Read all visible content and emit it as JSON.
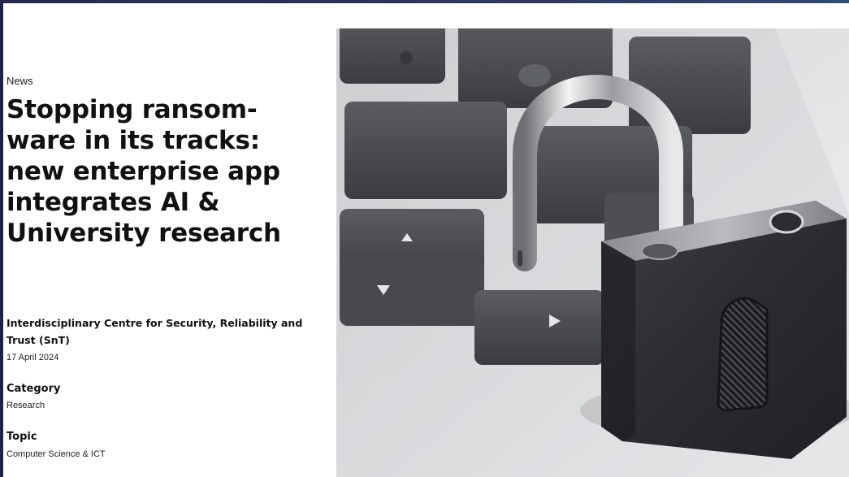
{
  "article": {
    "section": "News",
    "title": "Stopping ransom-ware in its tracks: new enterprise app integrates AI & University research",
    "title_lines": [
      "Stopping ransom-",
      "ware in its tracks:",
      "new enterprise app",
      "integrates AI &",
      "University research"
    ],
    "organization": "Interdisciplinary Centre for Security, Reliability and Trust (SnT)",
    "date": "17 April 2024"
  },
  "meta": {
    "category_label": "Category",
    "category_value": "Research",
    "topic_label": "Topic",
    "topic_value": "Computer Science & ICT"
  },
  "hero": {
    "subject": "padlock-on-keyboard-image"
  }
}
